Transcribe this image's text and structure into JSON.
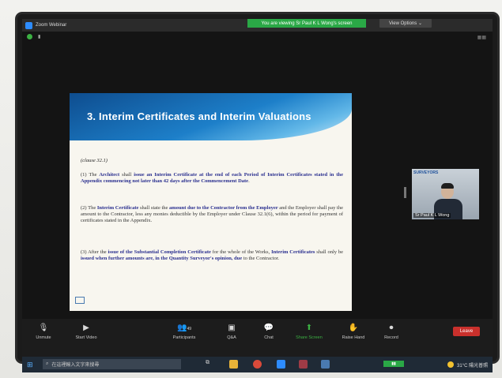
{
  "window": {
    "app_title": "Zoom Webinar"
  },
  "banner": {
    "viewing": "You are viewing Sr Paul K L Wong's screen",
    "view_options": "View Options ⌄"
  },
  "slide": {
    "title": "3. Interim Certificates and Interim Valuations",
    "clause": "(clause 32.1)",
    "para1_html": "(1) The <b>Architect</b> shall <b>issue an Interim Certificate at the end of each Period of Interim Certificates stated in the Appendix commencing not later than 42 days after the Commencement Date</b>.",
    "para2_html": "(2) The <b>Interim Certificate</b> shall state the <b>amount due to the Contractor from the Employer</b> and the Employer shall pay the amount to the Contractor, less any monies deductible by the Employer under Clause 32.1(6), within the period for payment of certificates stated in the Appendix.",
    "para3_html": "(3) After the <b>issue of the Substantial Completion Certificate</b> for the whole of the Works, <b>Interim Certificates</b> shall only be <b>issued when further amounts are, in the Quantity Surveyor's opinion, due</b> to the Contractor."
  },
  "speaker": {
    "name": "Sr Paul K L Wong",
    "logo": "SURVEYORS"
  },
  "toolbar": {
    "unmute": "Unmute",
    "start_video": "Start Video",
    "participants": "Participants",
    "participants_count": "49",
    "qa": "Q&A",
    "chat": "Chat",
    "share_screen": "Share Screen",
    "raise_hand": "Raise Hand",
    "record": "Record",
    "leave": "Leave"
  },
  "taskbar": {
    "search_placeholder": "在這裡輸入文字來搜尋",
    "weather": "31°C 陽光普照"
  },
  "colors": {
    "zoom_blue": "#2d8cff",
    "share_green": "#3cb043",
    "leave_red": "#c9302c"
  }
}
